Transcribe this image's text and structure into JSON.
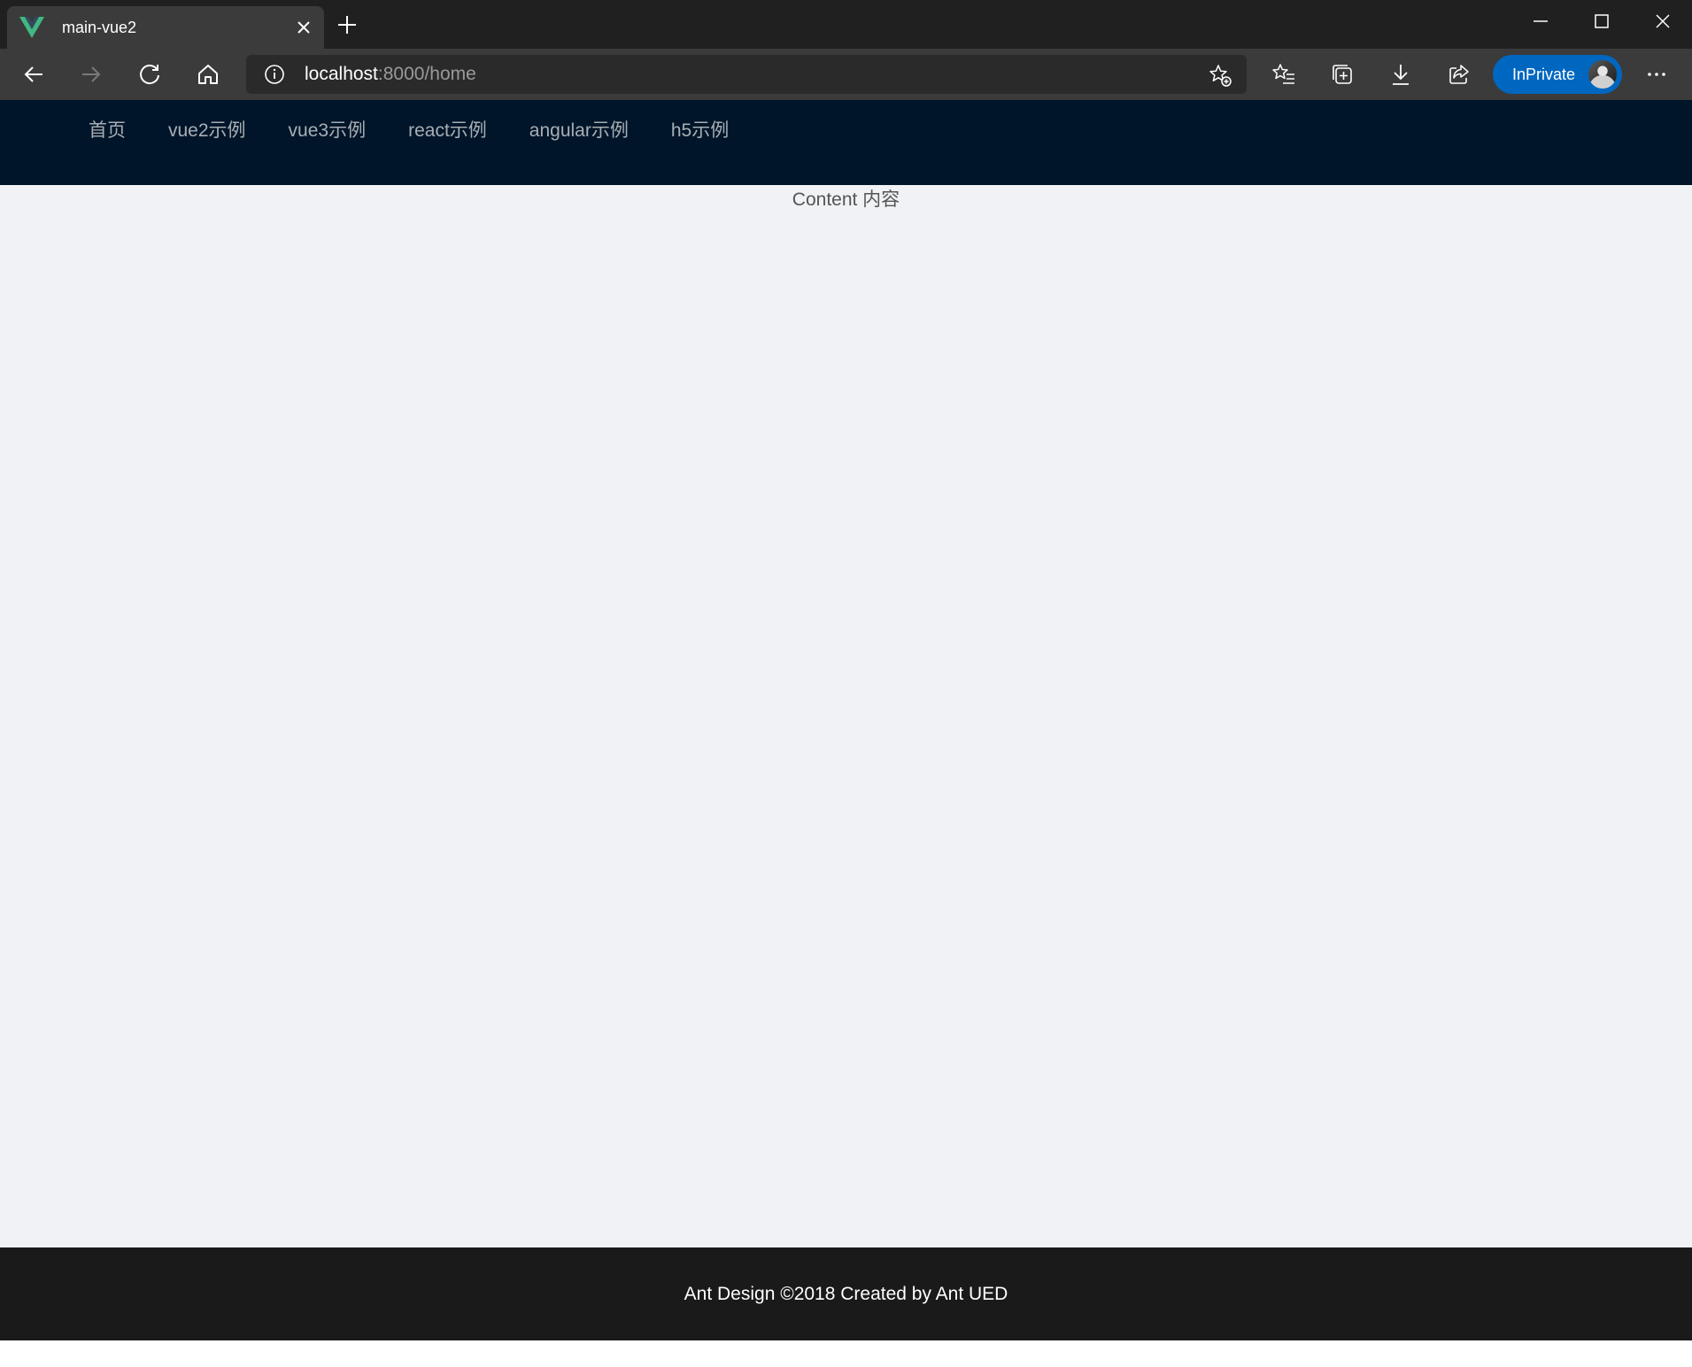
{
  "browser": {
    "tab": {
      "title": "main-vue2",
      "favicon": "vue-logo-icon"
    },
    "address": {
      "host": "localhost",
      "path": ":8000/home"
    },
    "inprivate_label": "InPrivate",
    "colors": {
      "titlebar": "#202020",
      "toolbar": "#3b3b3b",
      "accent": "#0067c0"
    }
  },
  "app": {
    "nav": {
      "items": [
        {
          "label": "首页"
        },
        {
          "label": "vue2示例"
        },
        {
          "label": "vue3示例"
        },
        {
          "label": "react示例"
        },
        {
          "label": "angular示例"
        },
        {
          "label": "h5示例"
        }
      ]
    },
    "content": {
      "text": "Content 内容"
    },
    "footer": {
      "text": "Ant Design ©2018 Created by Ant UED"
    },
    "colors": {
      "header": "#001529",
      "content": "#f0f2f5",
      "footer": "#1a1a1a"
    }
  }
}
